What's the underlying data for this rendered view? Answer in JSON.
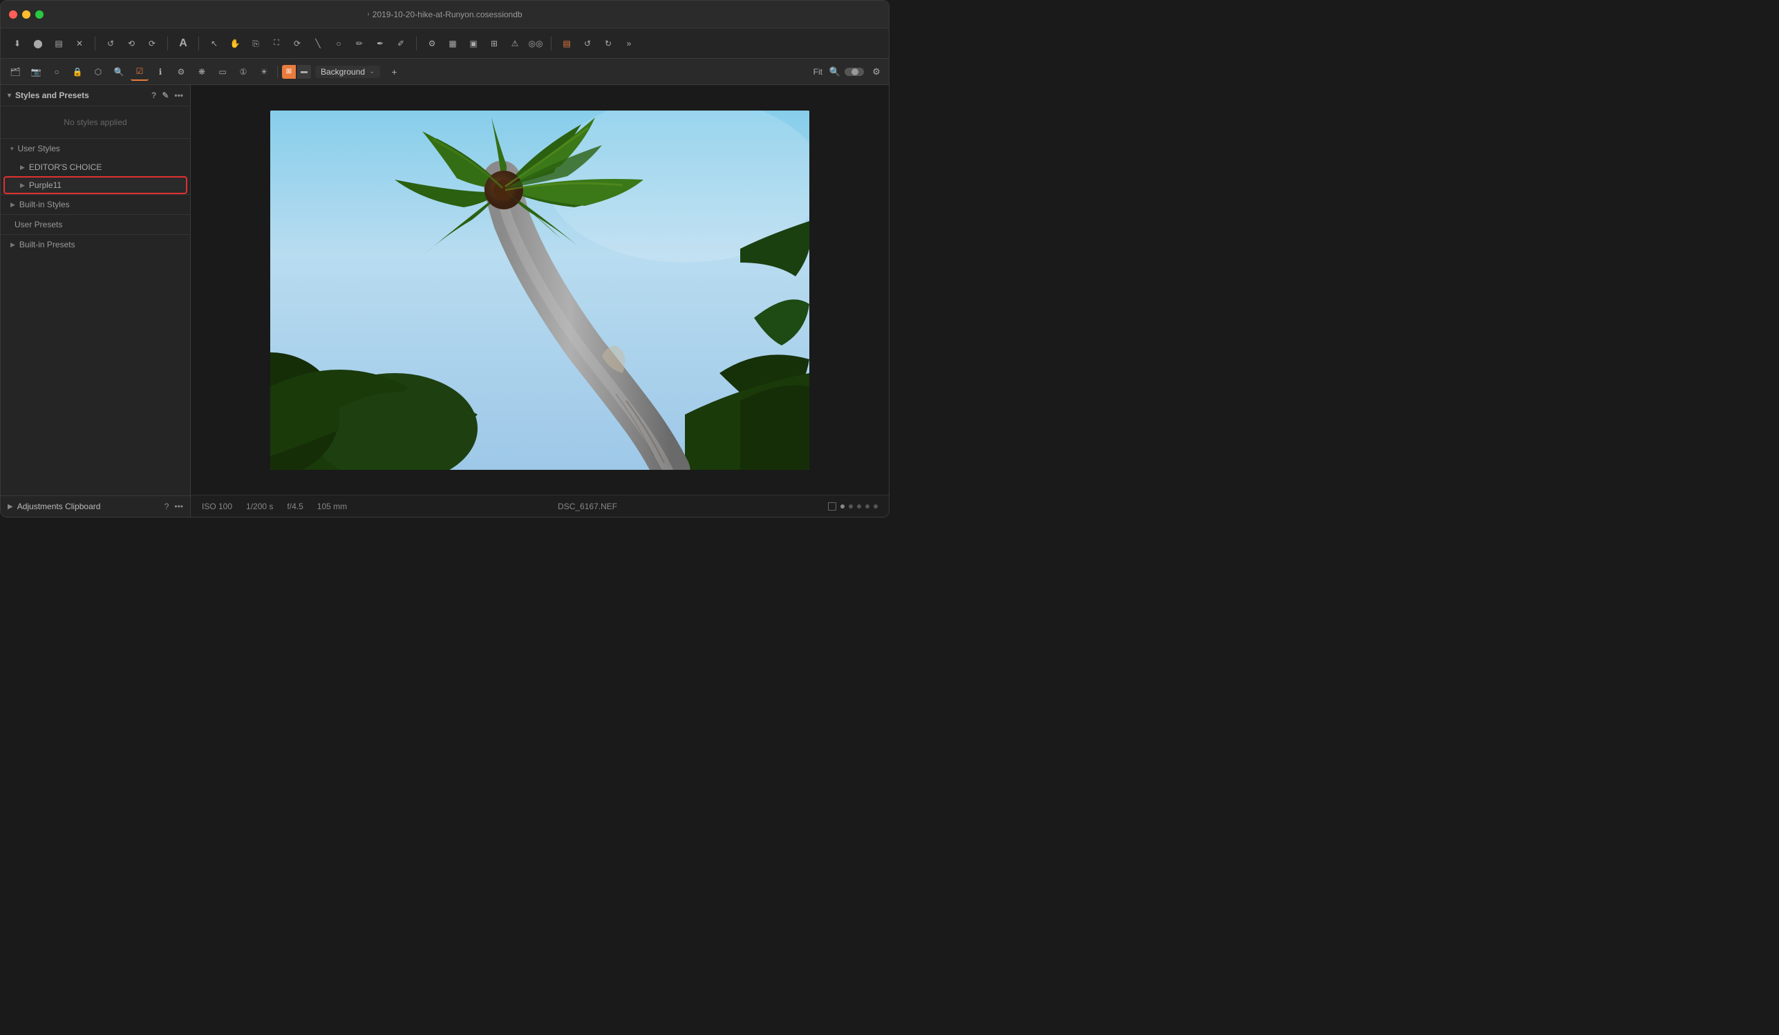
{
  "window": {
    "title": "2019-10-20-hike-at-Runyon.cosessiondb",
    "title_icon": "›"
  },
  "toolbar": {
    "buttons": [
      {
        "name": "import",
        "icon": "⬇",
        "active": false
      },
      {
        "name": "capture",
        "icon": "⬤",
        "active": false
      },
      {
        "name": "album",
        "icon": "▤",
        "active": false
      },
      {
        "name": "close",
        "icon": "✕",
        "active": false
      },
      {
        "name": "undo",
        "icon": "↺",
        "active": false
      },
      {
        "name": "redo-back",
        "icon": "⟲",
        "active": false
      },
      {
        "name": "redo",
        "icon": "⟳",
        "active": false
      },
      {
        "name": "text",
        "icon": "A",
        "active": false
      },
      {
        "name": "select",
        "icon": "↖",
        "active": false
      },
      {
        "name": "hand",
        "icon": "✋",
        "active": false
      },
      {
        "name": "clone",
        "icon": "⎘",
        "active": false
      },
      {
        "name": "crop",
        "icon": "⌧",
        "active": false
      },
      {
        "name": "heal",
        "icon": "⟳",
        "active": false
      },
      {
        "name": "line",
        "icon": "╲",
        "active": false
      },
      {
        "name": "circle",
        "icon": "○",
        "active": false
      },
      {
        "name": "brush",
        "icon": "✏",
        "active": false
      },
      {
        "name": "pen",
        "icon": "✒",
        "active": false
      },
      {
        "name": "eraser",
        "icon": "✏",
        "active": false
      },
      {
        "name": "settings",
        "icon": "⚙",
        "active": false
      },
      {
        "name": "grid",
        "icon": "▦",
        "active": false
      },
      {
        "name": "overlay",
        "icon": "▣",
        "active": false
      },
      {
        "name": "grid2",
        "icon": "⊞",
        "active": false
      },
      {
        "name": "warning",
        "icon": "⚠",
        "active": false
      },
      {
        "name": "glasses",
        "icon": "◎",
        "active": false
      },
      {
        "name": "layers",
        "icon": "▤",
        "active": true
      },
      {
        "name": "refresh",
        "icon": "↺",
        "active": false
      },
      {
        "name": "refresh2",
        "icon": "↻",
        "active": false
      },
      {
        "name": "more",
        "icon": "»",
        "active": false
      }
    ]
  },
  "toolbar2": {
    "buttons": [
      {
        "name": "folder",
        "icon": "📁",
        "active": false
      },
      {
        "name": "camera2",
        "icon": "📷",
        "active": false
      },
      {
        "name": "circle2",
        "icon": "○",
        "active": false
      },
      {
        "name": "lock",
        "icon": "🔒",
        "active": false
      },
      {
        "name": "stamp",
        "icon": "⬡",
        "active": false
      },
      {
        "name": "search",
        "icon": "🔍",
        "active": false
      },
      {
        "name": "checkbox",
        "icon": "☑",
        "active": true
      },
      {
        "name": "info",
        "icon": "ℹ",
        "active": false
      },
      {
        "name": "gear2",
        "icon": "⚙",
        "active": false
      },
      {
        "name": "flower",
        "icon": "❋",
        "active": false
      },
      {
        "name": "rect",
        "icon": "▭",
        "active": false
      },
      {
        "name": "badge",
        "icon": "①",
        "active": false
      },
      {
        "name": "sun",
        "icon": "☀",
        "active": false
      }
    ],
    "layer_selector": {
      "name": "Background",
      "add_label": "+"
    },
    "fit_label": "Fit"
  },
  "sidebar": {
    "styles_presets": {
      "header": "Styles and Presets",
      "no_styles_text": "No styles applied",
      "user_styles": {
        "label": "User Styles",
        "children": [
          {
            "label": "EDITOR'S CHOICE",
            "expanded": false
          },
          {
            "label": "Purple11",
            "highlighted": true,
            "expanded": false
          }
        ]
      },
      "built_in_styles": {
        "label": "Built-in Styles"
      },
      "user_presets": {
        "label": "User Presets"
      },
      "built_in_presets": {
        "label": "Built-in Presets"
      }
    },
    "adjustments_clipboard": {
      "header": "Adjustments Clipboard"
    }
  },
  "status_bar": {
    "iso": "ISO 100",
    "shutter": "1/200 s",
    "aperture": "f/4.5",
    "focal": "105 mm",
    "filename": "DSC_6167.NEF"
  },
  "photo": {
    "description": "Palm tree viewed from below against blue sky"
  }
}
